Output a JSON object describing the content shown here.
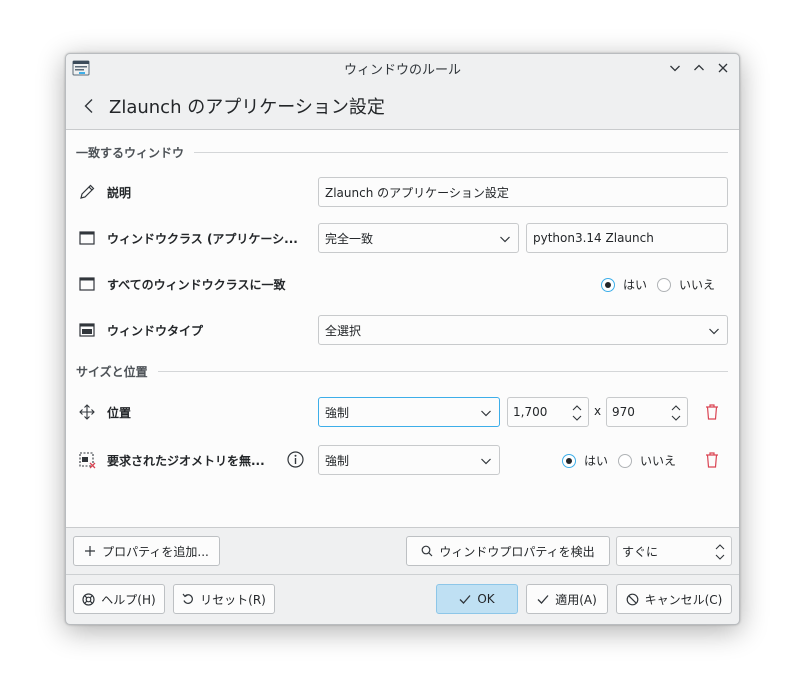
{
  "window": {
    "title": "ウィンドウのルール"
  },
  "header": {
    "title": "Zlaunch のアプリケーション設定"
  },
  "sections": {
    "match": "一致するウィンドウ",
    "size": "サイズと位置"
  },
  "rows": {
    "description": {
      "label": "説明",
      "value": "Zlaunch のアプリケーション設定"
    },
    "window_class": {
      "label": "ウィンドウクラス (アプリケーシ...",
      "match_type": "完全一致",
      "value": "python3.14 Zlaunch"
    },
    "whole_class": {
      "label": "すべてのウィンドウクラスに一致",
      "yes": "はい",
      "no": "いいえ",
      "selected": "yes"
    },
    "window_type": {
      "label": "ウィンドウタイプ",
      "value": "全選択"
    },
    "position": {
      "label": "位置",
      "policy": "強制",
      "x": "1,700",
      "sep": "x",
      "y": "970"
    },
    "ignore_geometry": {
      "label": "要求されたジオメトリを無...",
      "policy": "強制",
      "yes": "はい",
      "no": "いいえ",
      "selected": "yes"
    }
  },
  "actions": {
    "add_property": "プロパティを追加...",
    "detect": "ウィンドウプロパティを検出",
    "detect_delay": "すぐに"
  },
  "footer": {
    "help": "ヘルプ(H)",
    "reset": "リセット(R)",
    "ok": "OK",
    "apply": "適用(A)",
    "cancel": "キャンセル(C)"
  },
  "colors": {
    "accent": "#3daee9",
    "delete": "#da4453",
    "ok_bg": "#bfe0f3"
  },
  "icons": [
    "app-icon",
    "minimize-icon",
    "maximize-icon",
    "close-icon",
    "back-icon",
    "pencil-icon",
    "window-icon",
    "window-type-icon",
    "move-icon",
    "geometry-icon",
    "info-icon",
    "trash-icon",
    "plus-icon",
    "search-icon",
    "help-icon",
    "reset-icon",
    "check-icon",
    "cancel-icon"
  ]
}
